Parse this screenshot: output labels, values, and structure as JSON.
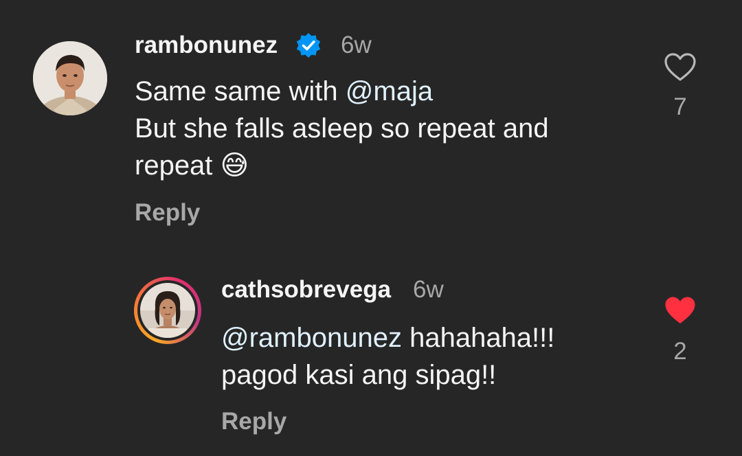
{
  "comments": [
    {
      "username": "rambonunez",
      "verified": true,
      "time": "6w",
      "line1_prefix": "Same same with ",
      "line1_mention": "@maja",
      "line2": "But she falls asleep so repeat and",
      "line3": "repeat",
      "emoji": "😅",
      "reply_label": "Reply",
      "likes": "7",
      "liked": false
    },
    {
      "username": "cathsobrevega",
      "verified": false,
      "time": "6w",
      "line1_mention": "@rambonunez",
      "line1_suffix": " hahahaha!!!",
      "line2": "pagod kasi ang sipag!!",
      "reply_label": "Reply",
      "likes": "2",
      "liked": true
    }
  ],
  "colors": {
    "background": "#262626",
    "liked_heart": "#ff3040",
    "verified_badge": "#0095f6",
    "story_ring_start": "#f9a825",
    "story_ring_end": "#c13584"
  }
}
